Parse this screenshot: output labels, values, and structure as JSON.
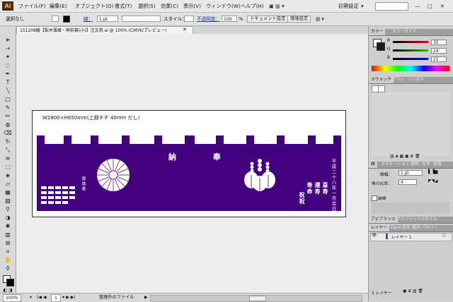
{
  "app": {
    "logo": "Ai",
    "workspace": "初期設定"
  },
  "menu": [
    "ファイル(F)",
    "編集(E)",
    "オブジェクト(O)",
    "書式(T)",
    "選択(S)",
    "効果(C)",
    "表示(V)",
    "ウィンドウ(W)",
    "ヘルプ(H)"
  ],
  "control": {
    "selection": "選択なし",
    "stroke_label": "線：",
    "stroke_weight": "1 pt",
    "style_label": "スタイル：",
    "opacity_label": "不透明度：",
    "opacity_value": "100",
    "opacity_unit": "%",
    "doc_settings": "ドキュメント設定",
    "prefs": "環境設定"
  },
  "document": {
    "tab_title": "151208暖【梨木薄様・神前幕(小)】注文用.ai @ 100% (CMYK/プレビュー)",
    "dimension_label": "W2800×H650mm(上部チチ 40mm だし)",
    "noren_title": "納 奉",
    "noren_color": "#42007e",
    "right_vertical_1": "平成二十八年一月吉日",
    "right_vertical_2": "喜寿",
    "right_vertical_3": "運寿",
    "right_vertical_4": "寿命",
    "right_vertical_5": "祝祝",
    "left_vertical": "寄進者"
  },
  "status": {
    "zoom": "100%",
    "page": "1",
    "file_status": "管理外のファイル"
  },
  "color_panel": {
    "tabs": [
      "カラー",
      "カラーガイド"
    ],
    "r_label": "R",
    "g_label": "G",
    "b_label": "B",
    "r": "35",
    "g": "24",
    "b": "21"
  },
  "swatch_panel": {
    "tabs": [
      "スウォッチ",
      "ブラシ",
      "シンボル"
    ]
  },
  "stroke_panel": {
    "tabs": [
      "線",
      "グラデーション",
      "透明",
      "文字",
      "段落"
    ],
    "weight_label": "線幅：",
    "weight_value": "1 pt",
    "miter_label": "角の比率：",
    "miter_value": "4",
    "dashed_label": "破線"
  },
  "appearance_panel": {
    "tabs": [
      "アピアランス",
      "グラフィックスタイル"
    ]
  },
  "layers_panel": {
    "tabs": [
      "レイヤー",
      "Open",
      "変形",
      "整列",
      "パスファ"
    ],
    "layer_name": "レイヤー 1",
    "layer_count": "1 レイヤー"
  }
}
